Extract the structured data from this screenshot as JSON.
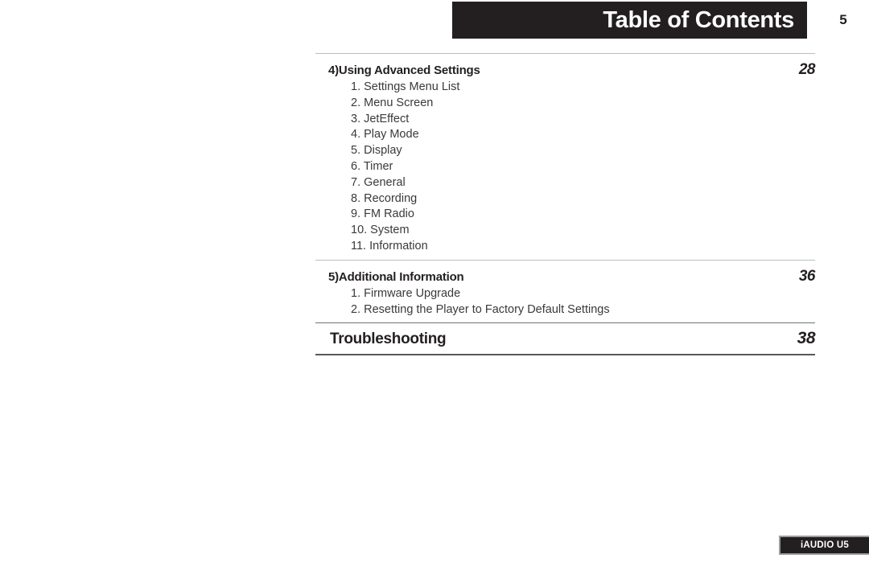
{
  "header": {
    "title": "Table of Contents",
    "page_number": "5"
  },
  "toc": {
    "sections": [
      {
        "title": "4)Using Advanced Settings",
        "page": "28",
        "items": [
          "1. Settings Menu List",
          "2. Menu Screen",
          "3. JetEffect",
          "4. Play Mode",
          "5. Display",
          "6. Timer",
          "7. General",
          "8. Recording",
          "9. FM Radio",
          "10. System",
          "11. Information"
        ]
      },
      {
        "title": "5)Additional Information",
        "page": "36",
        "items": [
          "1. Firmware Upgrade",
          "2. Resetting the Player to Factory Default Settings"
        ]
      }
    ],
    "final_entry": {
      "title": "Troubleshooting",
      "page": "38"
    }
  },
  "footer": {
    "product_badge": "iAUDIO U5"
  },
  "colors": {
    "ink": "#231f20",
    "rule_light": "#b9bec2",
    "rule_dark": "#55595c",
    "badge_border": "#9a9da0",
    "paper": "#ffffff"
  }
}
